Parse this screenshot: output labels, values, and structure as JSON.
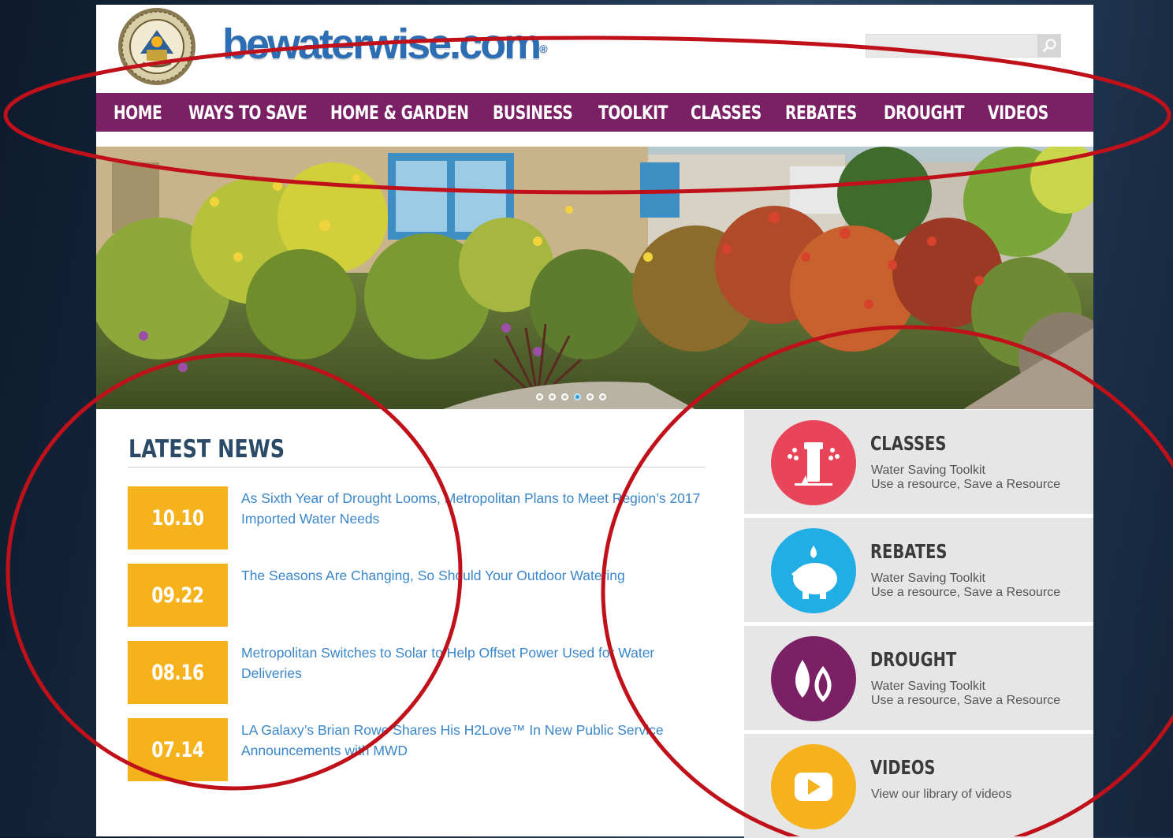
{
  "header": {
    "logo_text": "bewaterwise.com",
    "logo_reg": "®",
    "search_placeholder": ""
  },
  "nav": {
    "items": [
      "HOME",
      "WAYS TO SAVE",
      "HOME & GARDEN",
      "BUSINESS",
      "TOOLKIT",
      "CLASSES",
      "REBATES",
      "DROUGHT",
      "VIDEOS"
    ]
  },
  "carousel": {
    "slide_count": 6,
    "active_index": 3
  },
  "news": {
    "title": "LATEST NEWS",
    "items": [
      {
        "date": "10.10",
        "headline": "As Sixth Year of Drought Looms, Metropolitan Plans to Meet Region’s 2017 Imported Water Needs"
      },
      {
        "date": "09.22",
        "headline": "The Seasons Are Changing, So Should Your Outdoor Watering"
      },
      {
        "date": "08.16",
        "headline": "Metropolitan Switches to Solar to Help Offset Power Used for Water Deliveries"
      },
      {
        "date": "07.14",
        "headline": "LA Galaxy’s Brian Rowe Shares His H2Love™ In New Public Service Announcements with MWD"
      }
    ]
  },
  "side": {
    "cards": [
      {
        "title": "CLASSES",
        "line1": "Water Saving Toolkit",
        "line2": "Use a resource, Save a Resource",
        "icon": "sprinkler-icon",
        "color": "#e8455a"
      },
      {
        "title": "REBATES",
        "line1": "Water Saving Toolkit",
        "line2": "Use a resource, Save a Resource",
        "icon": "piggy-bank-icon",
        "color": "#20aee4"
      },
      {
        "title": "DROUGHT",
        "line1": "Water Saving Toolkit",
        "line2": "Use a resource, Save a Resource",
        "icon": "water-drops-icon",
        "color": "#7b2065"
      },
      {
        "title": "VIDEOS",
        "line1": "View our library of videos",
        "line2": "",
        "icon": "play-button-icon",
        "color": "#f5b21c"
      }
    ]
  },
  "colors": {
    "nav_bg": "#7b2065",
    "date_bg": "#f5b21c",
    "link": "#3a86c8",
    "annotation": "#c0111a"
  }
}
